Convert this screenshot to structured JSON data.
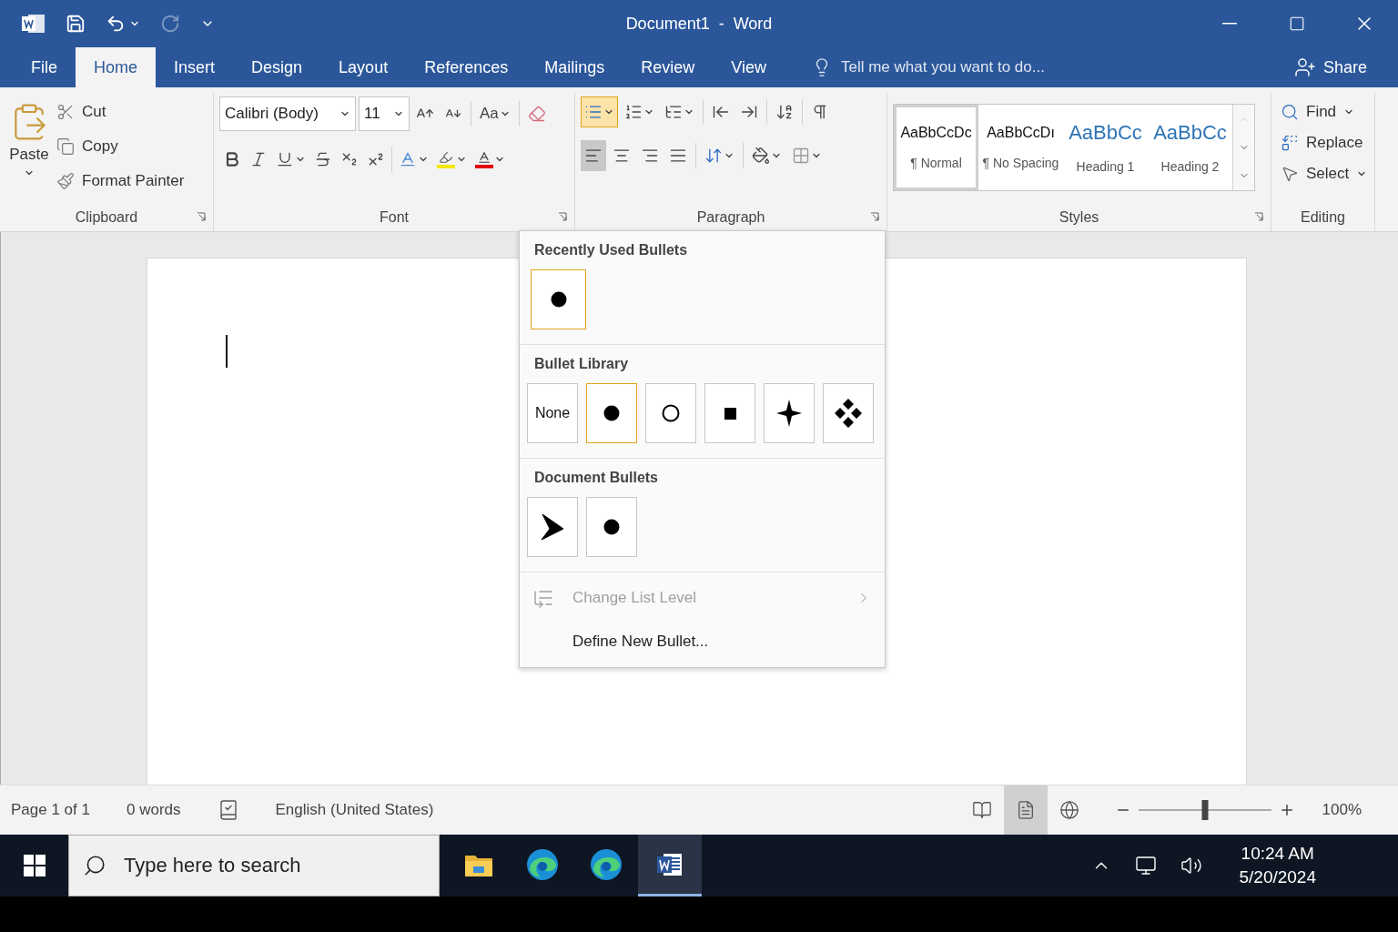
{
  "title_bar": {
    "title": "Document1  -  Word",
    "redo_disabled": true
  },
  "tabs": [
    {
      "label": "File",
      "selected": false
    },
    {
      "label": "Home",
      "selected": true
    },
    {
      "label": "Insert",
      "selected": false
    },
    {
      "label": "Design",
      "selected": false
    },
    {
      "label": "Layout",
      "selected": false
    },
    {
      "label": "References",
      "selected": false
    },
    {
      "label": "Mailings",
      "selected": false
    },
    {
      "label": "Review",
      "selected": false
    },
    {
      "label": "View",
      "selected": false
    }
  ],
  "tell_me": {
    "placeholder": "Tell me what you want to do..."
  },
  "share": "Share",
  "ribbon": {
    "clipboard": {
      "label": "Clipboard",
      "paste": "Paste",
      "items": [
        {
          "kind": "cut",
          "label": "Cut"
        },
        {
          "kind": "copy",
          "label": "Copy"
        },
        {
          "kind": "format_painter",
          "label": "Format Painter"
        }
      ]
    },
    "font": {
      "label": "Font",
      "font_name": "Calibri (Body)",
      "font_size": "11",
      "change_case": "Aa"
    },
    "paragraph": {
      "label": "Paragraph",
      "bullets_on": true,
      "alignments": [
        {
          "kind": "left",
          "selected": true
        },
        {
          "kind": "center",
          "selected": false
        },
        {
          "kind": "right",
          "selected": false
        },
        {
          "kind": "justify",
          "selected": false
        }
      ]
    },
    "styles": {
      "label": "Styles",
      "items": [
        {
          "kind": "normal",
          "preview": "AaBbCcDc",
          "name": "¶ Normal",
          "selected": true
        },
        {
          "kind": "normal",
          "preview": "AaBbCcDı",
          "name": "¶ No Spacing",
          "selected": false
        },
        {
          "kind": "heading",
          "preview": "AaBbCc",
          "name": "Heading 1",
          "selected": false
        },
        {
          "kind": "heading",
          "preview": "AaBbCc",
          "name": "Heading 2",
          "selected": false
        }
      ]
    },
    "editing": {
      "label": "Editing",
      "items": [
        {
          "kind": "find",
          "label": "Find"
        },
        {
          "kind": "replace",
          "label": "Replace"
        },
        {
          "kind": "select",
          "label": "Select"
        }
      ]
    }
  },
  "bullet_menu": {
    "sections": [
      {
        "title": "Recently Used Bullets",
        "items": [
          {
            "kind": "disc",
            "selected": true
          }
        ]
      },
      {
        "title": "Bullet Library",
        "items": [
          {
            "kind": "none",
            "label": "None",
            "selected": false
          },
          {
            "kind": "disc",
            "selected": true
          },
          {
            "kind": "circle",
            "selected": false
          },
          {
            "kind": "square",
            "selected": false
          },
          {
            "kind": "star",
            "selected": false
          },
          {
            "kind": "diamonds",
            "selected": false
          }
        ]
      },
      {
        "title": "Document Bullets",
        "items": [
          {
            "kind": "arrowhead",
            "selected": false
          },
          {
            "kind": "disc",
            "selected": false
          }
        ]
      }
    ],
    "actions": [
      {
        "kind": "change_level",
        "label": "Change List Level",
        "disabled": true,
        "submenu": true
      },
      {
        "kind": "define",
        "label": "Define New Bullet...",
        "disabled": false,
        "submenu": false
      }
    ]
  },
  "status_bar": {
    "page": "Page 1 of 1",
    "words": "0 words",
    "language": "English (United States)",
    "view_modes": [
      {
        "kind": "read",
        "selected": false
      },
      {
        "kind": "print",
        "selected": true
      },
      {
        "kind": "web",
        "selected": false
      }
    ],
    "zoom": {
      "level": 0.5,
      "reading": "100%"
    }
  },
  "taskbar": {
    "search": {
      "placeholder": "Type here to search"
    },
    "apps": [
      {
        "kind": "explorer",
        "selected": false
      },
      {
        "kind": "edge",
        "selected": false
      },
      {
        "kind": "edge",
        "selected": false
      },
      {
        "kind": "word",
        "selected": true
      }
    ],
    "time": "10:24 AM",
    "date": "5/20/2024"
  }
}
